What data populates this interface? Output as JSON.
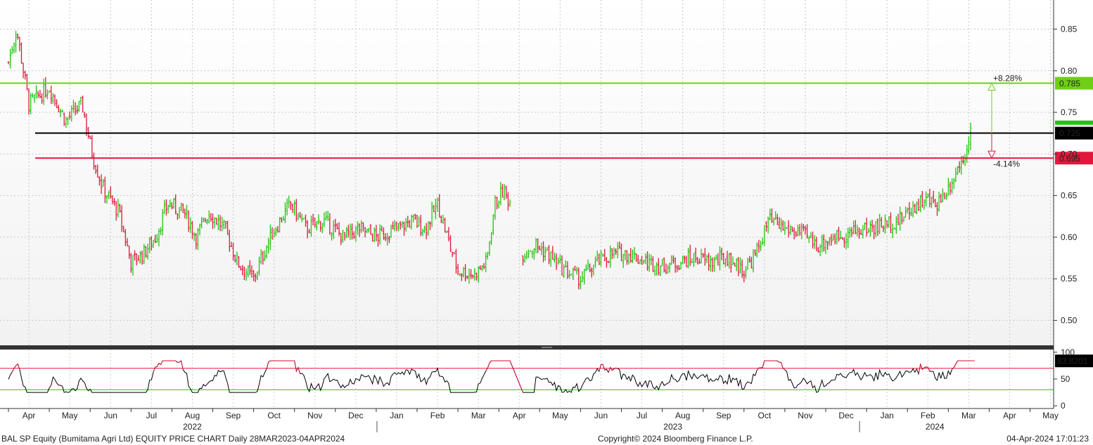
{
  "footer": {
    "title": "BAL SP Equity (Bumitama Agri Ltd) EQUITY PRICE CHART  Daily 28MAR2023-04APR2024",
    "copyright": "Copyright© 2024 Bloomberg Finance L.P.",
    "timestamp": "04-Apr-2024 17:01:23"
  },
  "chart_data": [
    {
      "type": "bar",
      "subtype": "ohlc",
      "up_color": "#22c40e",
      "down_color": "#e0183c",
      "yticks": [
        "0.50",
        "0.55",
        "0.60",
        "0.65",
        "0.70",
        "0.75",
        "0.80",
        "0.85"
      ],
      "ylim": [
        0.47,
        0.885
      ],
      "x_month_ticks": [
        "Apr",
        "May",
        "Jun",
        "Jul",
        "Aug",
        "Sep",
        "Oct",
        "Nov",
        "Dec",
        "Jan",
        "Feb",
        "Mar",
        "Apr",
        "May",
        "Jun",
        "Jul",
        "Aug",
        "Sep",
        "Oct",
        "Nov",
        "Dec",
        "Jan",
        "Feb",
        "Mar",
        "Apr",
        "May"
      ],
      "x_year_labels": [
        "2022",
        "2023",
        "2024"
      ],
      "price_anchors": [
        {
          "month_index": 0.0,
          "close": 0.81
        },
        {
          "month_index": 0.2,
          "close": 0.85
        },
        {
          "month_index": 0.5,
          "close": 0.76
        },
        {
          "month_index": 1.0,
          "close": 0.78
        },
        {
          "month_index": 1.4,
          "close": 0.74
        },
        {
          "month_index": 1.8,
          "close": 0.76
        },
        {
          "month_index": 2.05,
          "close": 0.7
        },
        {
          "month_index": 2.3,
          "close": 0.66
        },
        {
          "month_index": 2.7,
          "close": 0.63
        },
        {
          "month_index": 3.0,
          "close": 0.57
        },
        {
          "month_index": 3.3,
          "close": 0.58
        },
        {
          "month_index": 3.6,
          "close": 0.6
        },
        {
          "month_index": 3.9,
          "close": 0.64
        },
        {
          "month_index": 4.3,
          "close": 0.63
        },
        {
          "month_index": 4.6,
          "close": 0.6
        },
        {
          "month_index": 4.9,
          "close": 0.63
        },
        {
          "month_index": 5.3,
          "close": 0.61
        },
        {
          "month_index": 5.6,
          "close": 0.57
        },
        {
          "month_index": 6.0,
          "close": 0.55
        },
        {
          "month_index": 6.4,
          "close": 0.6
        },
        {
          "month_index": 6.9,
          "close": 0.64
        },
        {
          "month_index": 7.3,
          "close": 0.61
        },
        {
          "month_index": 7.7,
          "close": 0.62
        },
        {
          "month_index": 8.2,
          "close": 0.6
        },
        {
          "month_index": 8.6,
          "close": 0.61
        },
        {
          "month_index": 9.0,
          "close": 0.6
        },
        {
          "month_index": 9.5,
          "close": 0.61
        },
        {
          "month_index": 9.9,
          "close": 0.62
        },
        {
          "month_index": 10.2,
          "close": 0.61
        },
        {
          "month_index": 10.5,
          "close": 0.64
        },
        {
          "month_index": 10.8,
          "close": 0.59
        },
        {
          "month_index": 11.0,
          "close": 0.56
        },
        {
          "month_index": 11.4,
          "close": 0.555
        },
        {
          "month_index": 11.7,
          "close": 0.57
        },
        {
          "month_index": 11.9,
          "close": 0.64
        },
        {
          "month_index": 12.1,
          "close": 0.655
        },
        {
          "month_index": 12.3,
          "close": 0.64
        },
        {
          "month_index": 12.4,
          "close": null
        },
        {
          "month_index": 12.55,
          "close": 0.58
        },
        {
          "month_index": 12.9,
          "close": 0.59
        },
        {
          "month_index": 13.2,
          "close": 0.58
        },
        {
          "month_index": 13.6,
          "close": 0.56
        },
        {
          "month_index": 14.0,
          "close": 0.55
        },
        {
          "month_index": 14.4,
          "close": 0.57
        },
        {
          "month_index": 14.8,
          "close": 0.58
        },
        {
          "month_index": 15.2,
          "close": 0.58
        },
        {
          "month_index": 15.6,
          "close": 0.57
        },
        {
          "month_index": 16.0,
          "close": 0.565
        },
        {
          "month_index": 16.4,
          "close": 0.57
        },
        {
          "month_index": 16.8,
          "close": 0.575
        },
        {
          "month_index": 17.2,
          "close": 0.57
        },
        {
          "month_index": 17.6,
          "close": 0.575
        },
        {
          "month_index": 18.0,
          "close": 0.56
        },
        {
          "month_index": 18.3,
          "close": 0.58
        },
        {
          "month_index": 18.6,
          "close": 0.62
        },
        {
          "month_index": 19.0,
          "close": 0.61
        },
        {
          "month_index": 19.4,
          "close": 0.605
        },
        {
          "month_index": 19.8,
          "close": 0.59
        },
        {
          "month_index": 20.2,
          "close": 0.6
        },
        {
          "month_index": 20.6,
          "close": 0.605
        },
        {
          "month_index": 21.0,
          "close": 0.61
        },
        {
          "month_index": 21.4,
          "close": 0.615
        },
        {
          "month_index": 21.8,
          "close": 0.62
        },
        {
          "month_index": 22.1,
          "close": 0.635
        },
        {
          "month_index": 22.4,
          "close": 0.645
        },
        {
          "month_index": 22.7,
          "close": 0.64
        },
        {
          "month_index": 22.95,
          "close": 0.655
        },
        {
          "month_index": 23.2,
          "close": 0.68
        },
        {
          "month_index": 23.4,
          "close": 0.7
        },
        {
          "month_index": 23.55,
          "close": 0.73
        }
      ],
      "horizontal_lines": [
        {
          "value": 0.785,
          "color": "#6ecf16",
          "label": "0.785"
        },
        {
          "value": 0.725,
          "color": "#000000",
          "label": "0.725"
        },
        {
          "value": 0.695,
          "color": "#e0183c",
          "label": "0.695"
        }
      ],
      "last_price_marker": {
        "value": 0.73,
        "color": "#22c40e"
      },
      "annotations": [
        {
          "text": "+8.28%",
          "value": 0.785,
          "color": "#6ecf16"
        },
        {
          "text": "-4.14%",
          "value": 0.695,
          "color": "#e0183c"
        }
      ]
    },
    {
      "type": "line",
      "name": "RSI",
      "yticks": [
        "0",
        "50",
        "100"
      ],
      "ylim": [
        -5,
        105
      ],
      "reference_lines": [
        70,
        30
      ],
      "last_value_label": "83.8201",
      "last_value": 83.82
    }
  ]
}
